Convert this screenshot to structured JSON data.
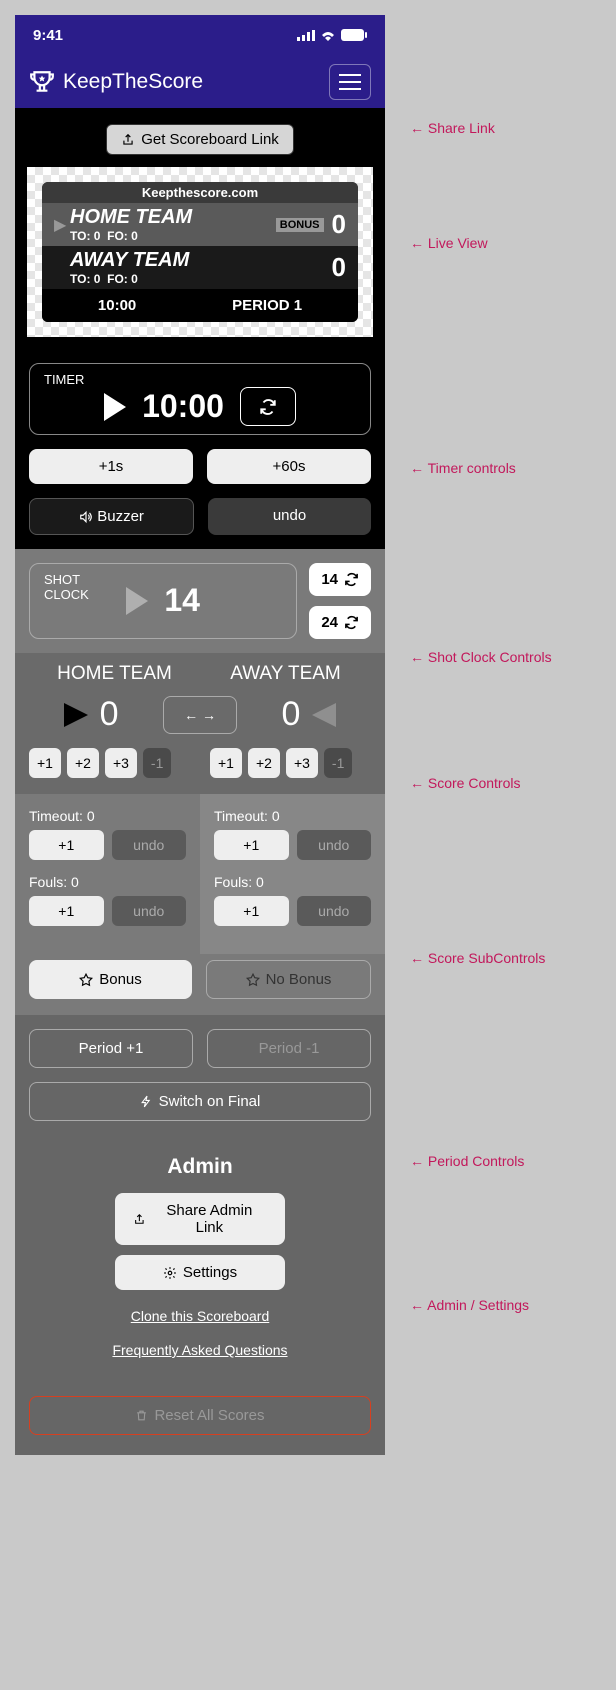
{
  "status": {
    "time": "9:41"
  },
  "brand": "KeepTheScore",
  "share": {
    "label": "Get Scoreboard Link"
  },
  "preview": {
    "site": "Keepthescore.com",
    "home": {
      "name": "HOME TEAM",
      "to": "TO: 0",
      "fo": "FO: 0",
      "bonus": "BONUS",
      "score": "0"
    },
    "away": {
      "name": "AWAY TEAM",
      "to": "TO: 0",
      "fo": "FO: 0",
      "score": "0"
    },
    "clock": "10:00",
    "period": "PERIOD  1"
  },
  "timer": {
    "label": "TIMER",
    "value": "10:00",
    "plus1": "+1s",
    "plus60": "+60s",
    "buzzer": "Buzzer",
    "undo": "undo"
  },
  "shot": {
    "label1": "SHOT",
    "label2": "CLOCK",
    "value": "14",
    "reset14": "14",
    "reset24": "24"
  },
  "scores": {
    "home_name": "HOME TEAM",
    "away_name": "AWAY TEAM",
    "home_score": "0",
    "away_score": "0",
    "swap": "← →",
    "p1": "+1",
    "p2": "+2",
    "p3": "+3",
    "m1": "-1"
  },
  "sub": {
    "home_to": "Timeout: 0",
    "home_fo": "Fouls: 0",
    "away_to": "Timeout: 0",
    "away_fo": "Fouls: 0",
    "plus1": "+1",
    "undo": "undo",
    "bonus": "Bonus",
    "nobonus": "No Bonus"
  },
  "period": {
    "inc": "Period +1",
    "dec": "Period -1",
    "final": "Switch on Final"
  },
  "admin": {
    "title": "Admin",
    "share": "Share Admin Link",
    "settings": "Settings",
    "clone": "Clone this Scoreboard",
    "faq": "Frequently Asked Questions",
    "reset": "Reset All Scores"
  },
  "annotations": {
    "share": "← Share Link",
    "live": "← Live View",
    "timer": "← Timer controls",
    "shot": "← Shot Clock Controls",
    "score": "← Score Controls",
    "sub": "← Score SubControls",
    "period": "← Period Controls",
    "admin": "← Admin / Settings"
  }
}
